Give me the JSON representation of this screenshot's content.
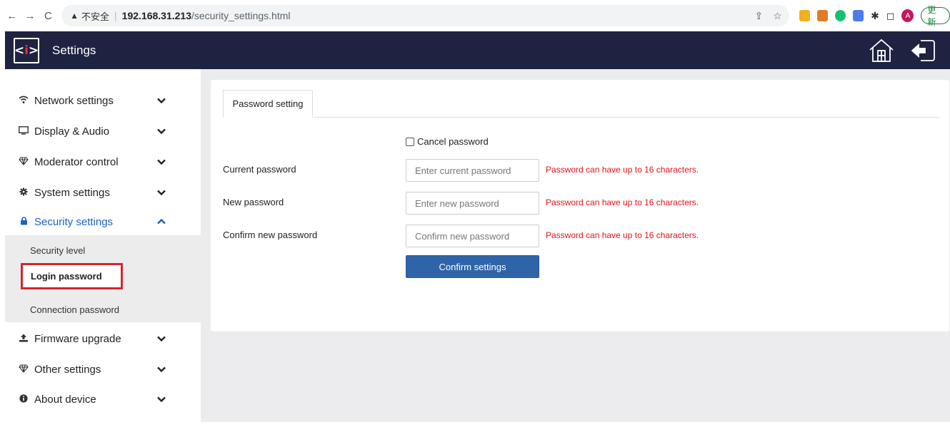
{
  "browser": {
    "back": "←",
    "forward": "→",
    "reload": "C",
    "insecure_label": "不安全",
    "url_host": "192.168.31.213",
    "url_path": "/security_settings.html",
    "update_label": "更新",
    "profile_initial": "A"
  },
  "header": {
    "logo_text_left": "<",
    "logo_text_mid": "i",
    "logo_text_right": ">",
    "title": "Settings"
  },
  "sidebar": {
    "items": [
      {
        "label": "Network settings",
        "icon": "wifi-icon"
      },
      {
        "label": "Display & Audio",
        "icon": "monitor-icon"
      },
      {
        "label": "Moderator control",
        "icon": "diamond-icon"
      },
      {
        "label": "System settings",
        "icon": "gear-icon"
      },
      {
        "label": "Security settings",
        "icon": "lock-icon"
      },
      {
        "label": "Firmware upgrade",
        "icon": "upload-icon"
      },
      {
        "label": "Other settings",
        "icon": "diamond-icon"
      },
      {
        "label": "About device",
        "icon": "info-icon"
      }
    ],
    "security_sub": [
      "Security level",
      "Login password",
      "Connection password"
    ]
  },
  "main": {
    "tab": "Password setting",
    "cancel_password_label": "Cancel password",
    "fields": [
      {
        "label": "Current password",
        "placeholder": "Enter current password",
        "hint": "Password can have up to 16 characters."
      },
      {
        "label": "New password",
        "placeholder": "Enter new password",
        "hint": "Password can have up to 16 characters."
      },
      {
        "label": "Confirm new password",
        "placeholder": "Confirm new password",
        "hint": "Password can have up to 16 characters."
      }
    ],
    "confirm_button": "Confirm settings"
  },
  "colors": {
    "header_bg": "#1d2340",
    "active_blue": "#1c62c4",
    "hint_red": "#e8101a",
    "button_blue": "#2e65a8",
    "highlight_red": "#d7242e"
  }
}
